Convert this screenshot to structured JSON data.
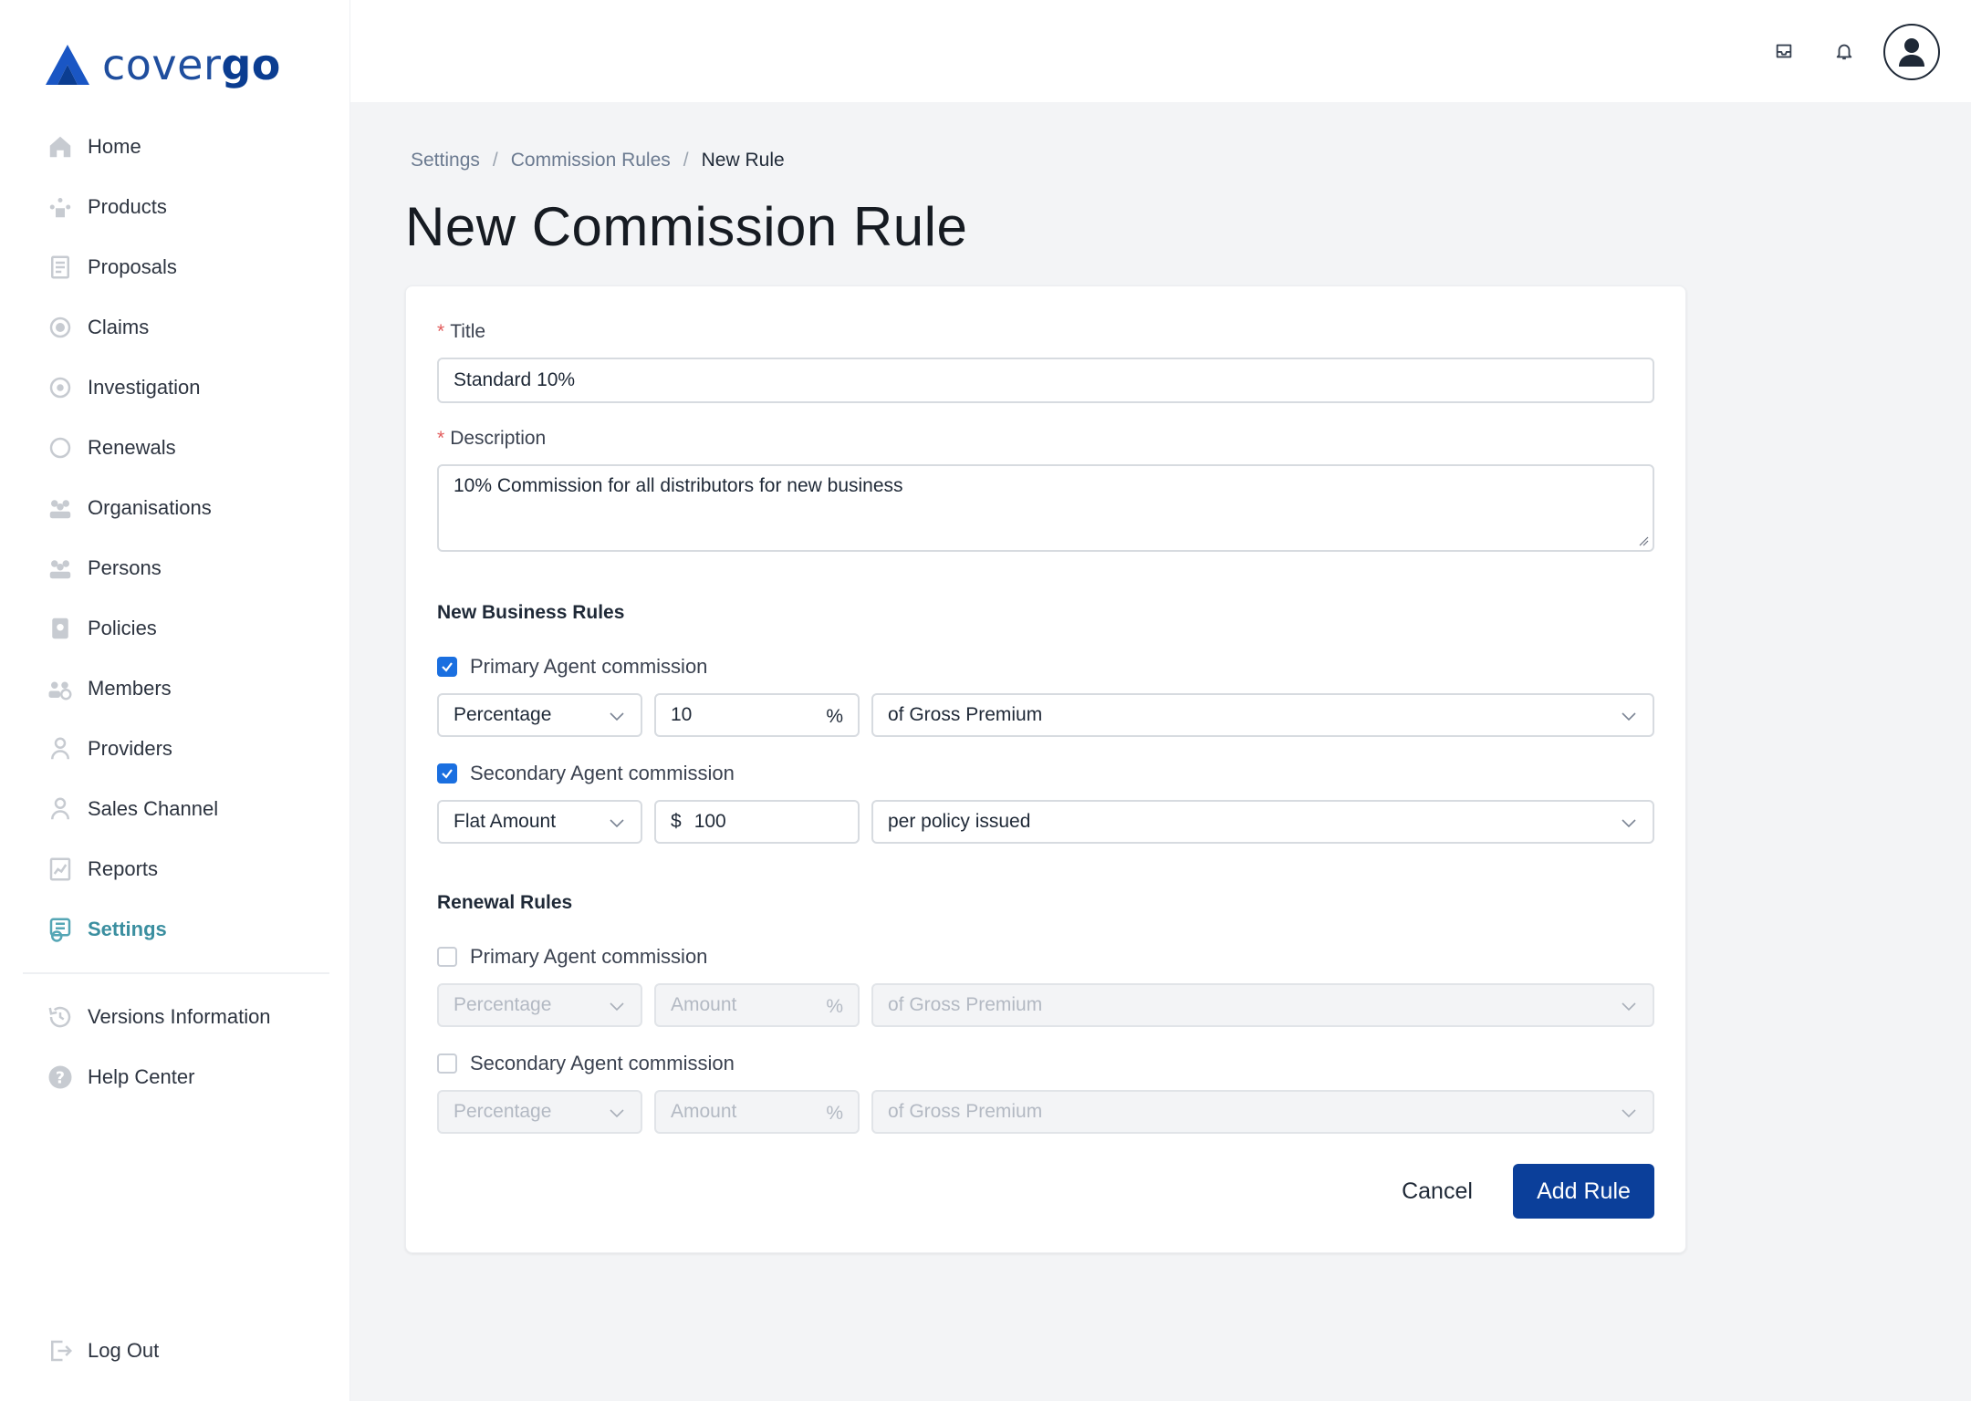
{
  "brand": {
    "name_prefix": "cover",
    "name_suffix": "go",
    "color": "#0b3d91"
  },
  "sidebar": {
    "items": [
      {
        "label": "Home",
        "icon": "home-icon"
      },
      {
        "label": "Products",
        "icon": "products-icon"
      },
      {
        "label": "Proposals",
        "icon": "proposals-icon"
      },
      {
        "label": "Claims",
        "icon": "claims-icon"
      },
      {
        "label": "Investigation",
        "icon": "investigation-icon"
      },
      {
        "label": "Renewals",
        "icon": "renewals-icon"
      },
      {
        "label": "Organisations",
        "icon": "organisations-icon"
      },
      {
        "label": "Persons",
        "icon": "persons-icon"
      },
      {
        "label": "Policies",
        "icon": "policies-icon"
      },
      {
        "label": "Members",
        "icon": "members-icon"
      },
      {
        "label": "Providers",
        "icon": "providers-icon"
      },
      {
        "label": "Sales Channel",
        "icon": "sales-channel-icon"
      },
      {
        "label": "Reports",
        "icon": "reports-icon"
      },
      {
        "label": "Settings",
        "icon": "settings-icon",
        "active": true
      }
    ],
    "secondary": [
      {
        "label": "Versions Information",
        "icon": "history-icon"
      },
      {
        "label": "Help Center",
        "icon": "help-icon"
      }
    ],
    "logout": {
      "label": "Log Out",
      "icon": "logout-icon"
    }
  },
  "topbar": {
    "icons": [
      "inbox-icon",
      "bell-icon",
      "user-avatar-icon"
    ]
  },
  "breadcrumb": {
    "items": [
      "Settings",
      "Commission Rules"
    ],
    "current": "New Rule"
  },
  "page_title": "New Commission Rule",
  "form": {
    "title": {
      "label": "Title",
      "value": "Standard 10%"
    },
    "description": {
      "label": "Description",
      "value": "10% Commission for all distributors for new business"
    },
    "new_business": {
      "heading": "New Business Rules",
      "primary": {
        "label": "Primary Agent commission",
        "checked": true,
        "type": "Percentage",
        "amount": "10",
        "unit": "%",
        "basis": "of Gross Premium"
      },
      "secondary": {
        "label": "Secondary Agent commission",
        "checked": true,
        "type": "Flat Amount",
        "currency": "$",
        "amount": "100",
        "basis": "per policy issued"
      }
    },
    "renewal": {
      "heading": "Renewal Rules",
      "primary": {
        "label": "Primary Agent commission",
        "checked": false,
        "type": "Percentage",
        "amount_placeholder": "Amount",
        "unit": "%",
        "basis": "of Gross Premium"
      },
      "secondary": {
        "label": "Secondary Agent commission",
        "checked": false,
        "type": "Percentage",
        "amount_placeholder": "Amount",
        "unit": "%",
        "basis": "of Gross Premium"
      }
    },
    "cancel_label": "Cancel",
    "submit_label": "Add Rule"
  },
  "colors": {
    "primary": "#0b3f9a",
    "accent": "#3b8fa0",
    "checkbox": "#1a6fe0",
    "required": "#e25b5b"
  }
}
